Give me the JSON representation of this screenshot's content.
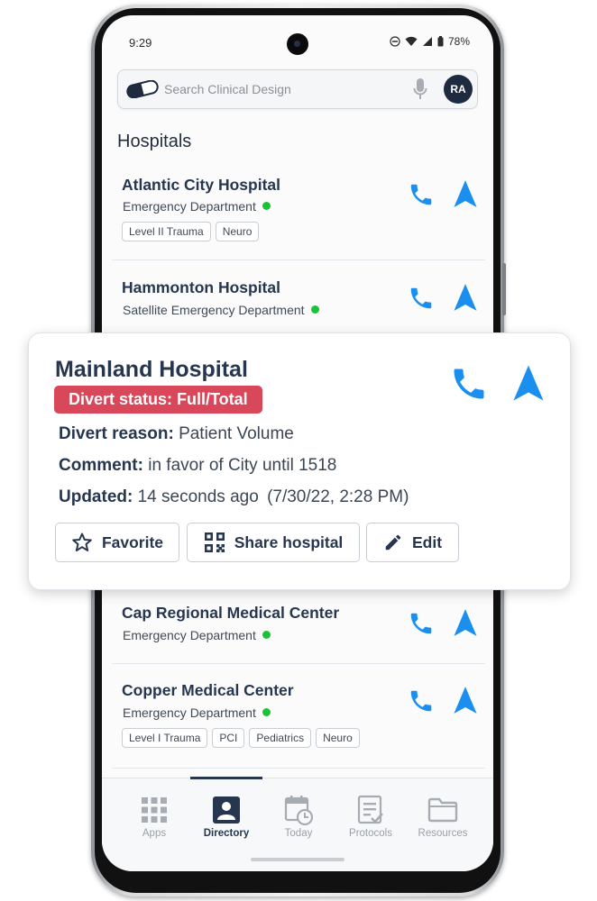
{
  "status_bar": {
    "time": "9:29",
    "battery": "78%"
  },
  "search": {
    "placeholder": "Search Clinical Design",
    "avatar_initials": "RA"
  },
  "section_title": "Hospitals",
  "hospitals": [
    {
      "name": "Atlantic City Hospital",
      "department": "Emergency Department",
      "tags": [
        "Level II Trauma",
        "Neuro"
      ]
    },
    {
      "name": "Hammonton Hospital",
      "department": "Satellite Emergency Department",
      "tags": []
    },
    {
      "name": "Cap Regional Medical Center",
      "department": "Emergency Department",
      "tags": []
    },
    {
      "name": "Copper Medical Center",
      "department": "Emergency Department",
      "tags": [
        "Level I Trauma",
        "PCI",
        "Pediatrics",
        "Neuro"
      ]
    }
  ],
  "detail": {
    "name": "Mainland Hospital",
    "divert_status": "Divert status: Full/Total",
    "divert_reason_label": "Divert reason:",
    "divert_reason": "Patient Volume",
    "comment_label": "Comment:",
    "comment": "in favor of City until 1518",
    "updated_label": "Updated:",
    "updated": "14 seconds ago",
    "updated_timestamp": "(7/30/22, 2:28 PM)",
    "favorite_label": "Favorite",
    "share_label": "Share hospital",
    "edit_label": "Edit"
  },
  "nav": [
    {
      "label": "Apps",
      "icon": "apps-grid-icon"
    },
    {
      "label": "Directory",
      "icon": "directory-icon"
    },
    {
      "label": "Today",
      "icon": "calendar-clock-icon"
    },
    {
      "label": "Protocols",
      "icon": "protocols-icon"
    },
    {
      "label": "Resources",
      "icon": "folder-icon"
    }
  ],
  "active_nav": "Directory",
  "colors": {
    "accent_blue": "#1a8ff0",
    "navy": "#27364f",
    "divert_red": "#d9475a",
    "status_green": "#19c236"
  }
}
